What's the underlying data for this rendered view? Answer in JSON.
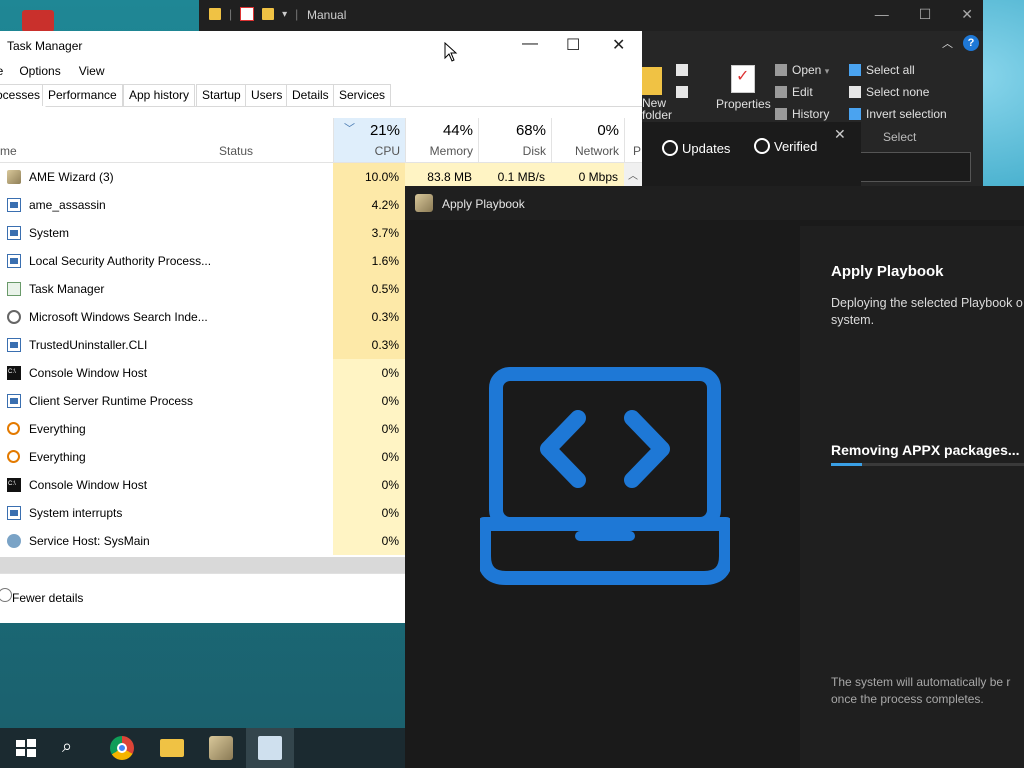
{
  "explorer": {
    "title": "Manual",
    "ribbon": {
      "new_folder": "New\nfolder",
      "properties": "Properties",
      "open": "Open",
      "edit": "Edit",
      "history": "History",
      "select_all": "Select all",
      "select_none": "Select none",
      "invert_selection": "Invert selection",
      "select_group": "Select"
    }
  },
  "task_manager": {
    "title": "Task Manager",
    "menu": [
      "le",
      "Options",
      "View"
    ],
    "tabs": [
      "ocesses",
      "Performance",
      "App history",
      "Startup",
      "Users",
      "Details",
      "Services"
    ],
    "columns": {
      "name": "me",
      "status": "Status",
      "cpu_pct": "21%",
      "cpu": "CPU",
      "mem_pct": "44%",
      "mem": "Memory",
      "disk_pct": "68%",
      "disk": "Disk",
      "net_pct": "0%",
      "net": "Network",
      "power": "P"
    },
    "processes": [
      {
        "name": "AME Wizard (3)",
        "cpu": "10.0%",
        "mem": "83.8 MB",
        "disk": "0.1 MB/s",
        "net": "0 Mbps"
      },
      {
        "name": "ame_assassin",
        "cpu": "4.2%"
      },
      {
        "name": "System",
        "cpu": "3.7%"
      },
      {
        "name": "Local Security Authority Process...",
        "cpu": "1.6%"
      },
      {
        "name": "Task Manager",
        "cpu": "0.5%"
      },
      {
        "name": "Microsoft Windows Search Inde...",
        "cpu": "0.3%"
      },
      {
        "name": "TrustedUninstaller.CLI",
        "cpu": "0.3%"
      },
      {
        "name": "Console Window Host",
        "cpu": "0%"
      },
      {
        "name": "Client Server Runtime Process",
        "cpu": "0%"
      },
      {
        "name": "Everything",
        "cpu": "0%"
      },
      {
        "name": "Everything",
        "cpu": "0%"
      },
      {
        "name": "Console Window Host",
        "cpu": "0%"
      },
      {
        "name": "System interrupts",
        "cpu": "0%"
      },
      {
        "name": "Service Host: SysMain",
        "cpu": "0%"
      }
    ],
    "fewer_details": "Fewer details"
  },
  "updates_bar": {
    "updates": "Updates",
    "verified": "Verified"
  },
  "ame": {
    "title": "Apply Playbook",
    "heading": "Apply Playbook",
    "description": "Deploying the selected Playbook o system.",
    "status": "Removing APPX packages...",
    "progress": 0.16,
    "footer": "The system will automatically be r once the process completes."
  },
  "colors": {
    "accent": "#3aa0e6",
    "cpu_highlight": "#fde9a8",
    "cell_highlight": "#fff4c4"
  }
}
